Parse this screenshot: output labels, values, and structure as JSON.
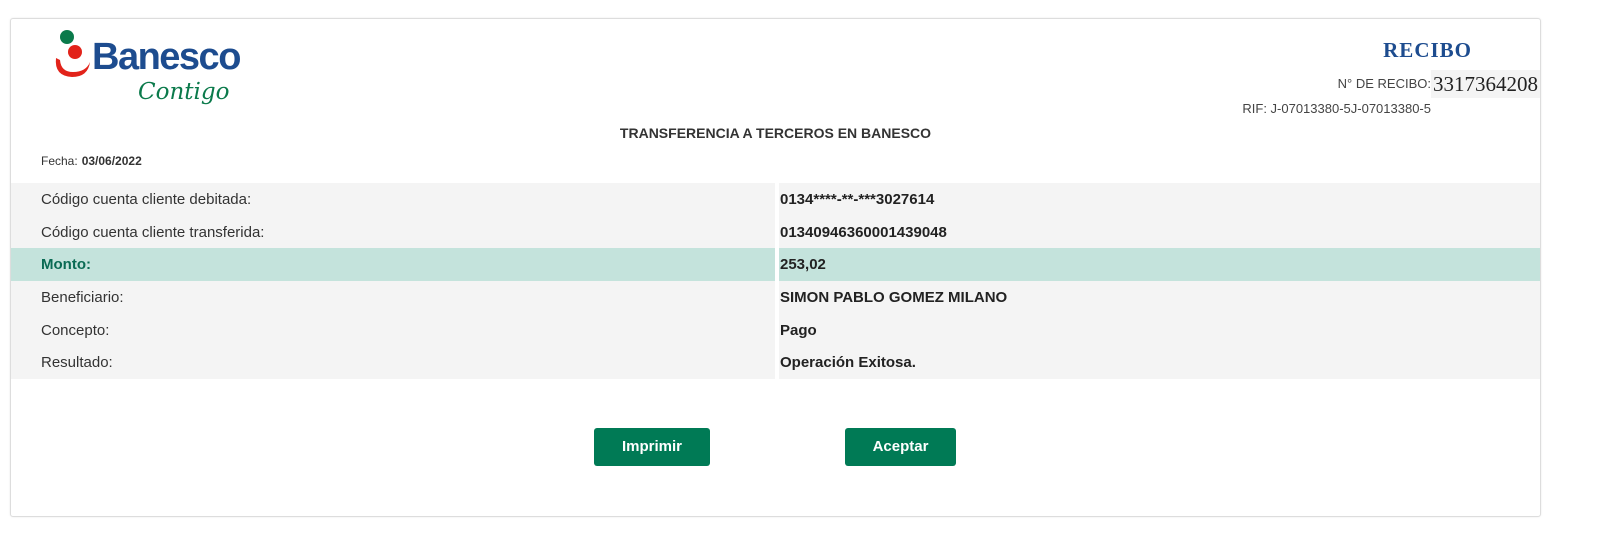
{
  "brand": {
    "name": "Banesco",
    "tagline": "Contigo",
    "colors": {
      "navy": "#1d4c8f",
      "green": "#0b7a4b",
      "red": "#e2231a"
    }
  },
  "receipt": {
    "title": "RECIBO",
    "number_label": "N° DE RECIBO:",
    "number_value": "3317364208",
    "rif": "RIF: J-07013380-5J-07013380-5"
  },
  "operation_title": "TRANSFERENCIA A TERCEROS EN BANESCO",
  "date": {
    "label": "Fecha:",
    "value": "03/06/2022"
  },
  "details": [
    {
      "label": "Código cuenta cliente debitada:",
      "value": "0134****-**-***3027614",
      "highlight": false
    },
    {
      "label": "Código cuenta cliente transferida:",
      "value": "01340946360001439048",
      "highlight": false
    },
    {
      "label": "Monto:",
      "value": "253,02",
      "highlight": true
    },
    {
      "label": "Beneficiario:",
      "value": "SIMON PABLO GOMEZ MILANO",
      "highlight": false
    },
    {
      "label": "Concepto:",
      "value": "Pago",
      "highlight": false
    },
    {
      "label": "Resultado:",
      "value": "Operación Exitosa.",
      "highlight": false
    }
  ],
  "actions": {
    "print_label": "Imprimir",
    "accept_label": "Aceptar"
  },
  "colors": {
    "button": "#007a55",
    "highlight_row": "#c4e3dc",
    "row_bg": "#f4f4f4"
  }
}
